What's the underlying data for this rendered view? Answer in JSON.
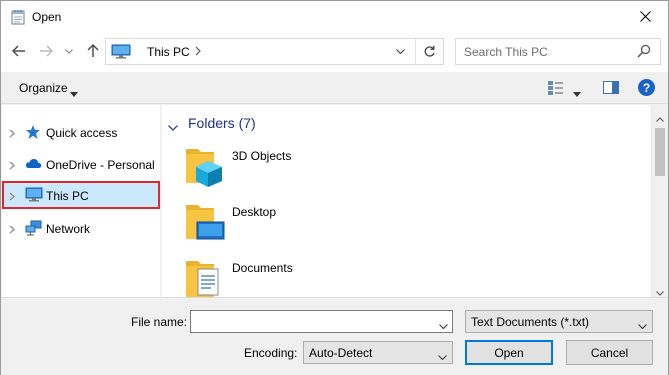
{
  "window": {
    "title": "Open",
    "title_icon": "notepad-icon",
    "close_glyph": "✕"
  },
  "nav": {
    "back_icon": "back-arrow-icon",
    "forward_icon": "forward-arrow-icon",
    "recent_icon": "chevron-down-icon",
    "up_icon": "up-arrow-icon",
    "address": {
      "location": "This PC",
      "icon": "computer-icon"
    },
    "refresh_icon": "refresh-icon",
    "search": {
      "placeholder": "Search This PC",
      "icon": "search-icon"
    }
  },
  "toolbar": {
    "organize_label": "Organize",
    "help_label": "?"
  },
  "sidebar": {
    "items": [
      {
        "label": "Quick access",
        "icon": "star-icon",
        "selected": false
      },
      {
        "label": "OneDrive - Personal",
        "icon": "cloud-icon",
        "selected": false
      },
      {
        "label": "This PC",
        "icon": "computer-icon",
        "selected": true
      },
      {
        "label": "Network",
        "icon": "network-icon",
        "selected": false
      }
    ]
  },
  "main": {
    "group_title": "Folders (7)",
    "folders": [
      {
        "name": "3D Objects",
        "icon": "3d-objects-folder-icon"
      },
      {
        "name": "Desktop",
        "icon": "desktop-folder-icon"
      },
      {
        "name": "Documents",
        "icon": "documents-folder-icon"
      }
    ]
  },
  "bottom": {
    "file_name_label": "File name:",
    "file_name_value": "",
    "file_type_value": "Text Documents (*.txt)",
    "encoding_label": "Encoding:",
    "encoding_value": "Auto-Detect",
    "open_label": "Open",
    "cancel_label": "Cancel"
  },
  "colors": {
    "accent": "#0078d7",
    "selection_bg": "#cce8ff",
    "highlight_border": "#e3262d",
    "group_title": "#1e3287",
    "folder_yellow": "#f6c343"
  }
}
